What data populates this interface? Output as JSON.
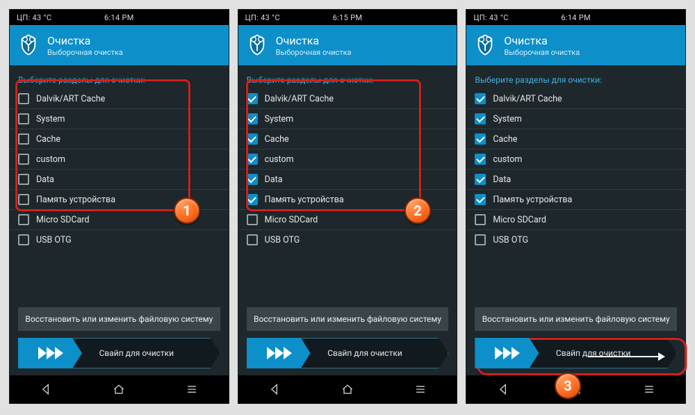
{
  "accent": "#0d8fc9",
  "statusbar": {
    "cpu_label": "ЦП: 43 °C"
  },
  "header": {
    "title": "Очистка",
    "subtitle": "Выборочная очистка"
  },
  "section_label": "Выберите разделы для очистки:",
  "partitions": [
    {
      "label": "Dalvik/ART Cache"
    },
    {
      "label": "System"
    },
    {
      "label": "Cache"
    },
    {
      "label": "custom"
    },
    {
      "label": "Data"
    },
    {
      "label": "Память устройства"
    },
    {
      "label": "Micro SDCard"
    },
    {
      "label": "USB OTG"
    }
  ],
  "restore_button": "Восстановить или изменить файловую систему",
  "swipe_label": "Свайп для очистки",
  "screens": [
    {
      "time": "6:14 PM",
      "checked": [
        false,
        false,
        false,
        false,
        false,
        false,
        false,
        false
      ]
    },
    {
      "time": "6:15 PM",
      "checked": [
        true,
        true,
        true,
        true,
        true,
        true,
        false,
        false
      ]
    },
    {
      "time": "6:14 PM",
      "checked": [
        true,
        true,
        true,
        true,
        true,
        true,
        false,
        false
      ]
    }
  ],
  "annotations": {
    "badge1": "1",
    "badge2": "2",
    "badge3": "3"
  }
}
